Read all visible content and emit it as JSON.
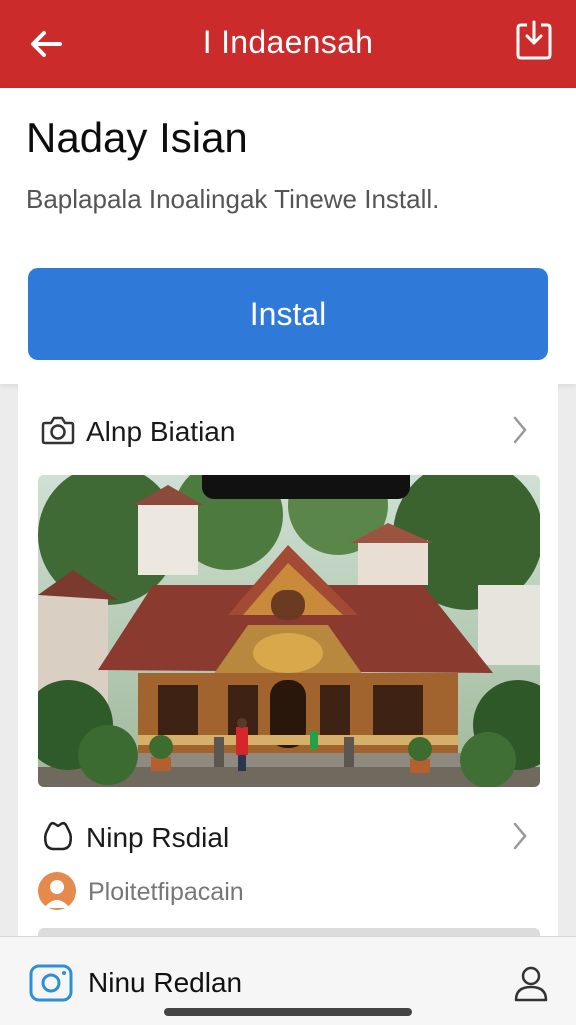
{
  "top_bar": {
    "title": "I Indaensah",
    "back_icon": "arrow-left-icon",
    "action_icon": "download-icon",
    "background_color": "#cc2b2b"
  },
  "app_header": {
    "name": "Naday Isian",
    "description": "Baplapala Inoalingak Tinewe Install.",
    "install_label": "Instal",
    "install_color": "#2f7ad9"
  },
  "sections": [
    {
      "label": "Alnp Biatian",
      "icon": "camera-icon"
    },
    {
      "label": "Ninp Rsdial",
      "icon": "bag-icon"
    }
  ],
  "meta": {
    "text": "Ploitetfipacain",
    "avatar_icon": "person-avatar-icon"
  },
  "bottom_bar": {
    "label": "Ninu Redlan",
    "left_icon": "instagram-icon",
    "right_icon": "profile-icon"
  }
}
